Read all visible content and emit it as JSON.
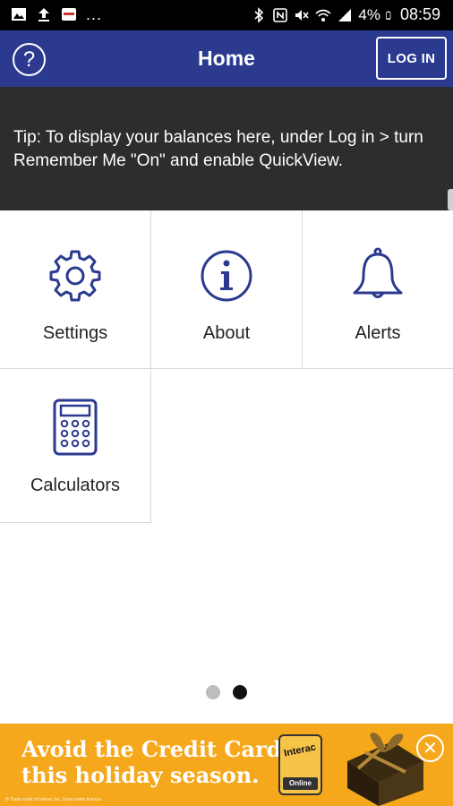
{
  "status_bar": {
    "notifications": [
      "image-icon",
      "upload-icon",
      "app-icon"
    ],
    "more_indicator": "...",
    "battery_percent": "4%",
    "time": "08:59",
    "icons": [
      "bluetooth-icon",
      "nfc-icon",
      "mute-icon",
      "wifi-icon",
      "signal-icon",
      "battery-icon"
    ]
  },
  "app_bar": {
    "title": "Home",
    "help_symbol": "?",
    "login_label": "LOG IN",
    "color": "#2b3a8f"
  },
  "tip": {
    "text": "Tip: To display your balances here, under Log in > turn Remember Me \"On\" and enable QuickView."
  },
  "tiles": [
    {
      "label": "Settings",
      "icon": "gear-icon"
    },
    {
      "label": "About",
      "icon": "info-icon"
    },
    {
      "label": "Alerts",
      "icon": "bell-icon"
    },
    {
      "label": "Calculators",
      "icon": "calculator-icon"
    }
  ],
  "page_indicator": {
    "total": 2,
    "current": 2
  },
  "ad": {
    "line1": "Avoid the Credit Card",
    "line2": "this holiday season.",
    "badge_top": "Interac",
    "badge_bottom": "Online",
    "fine_print": "® Trade-mark of Interac Inc. Used under licence.",
    "color": "#f5a81c"
  }
}
